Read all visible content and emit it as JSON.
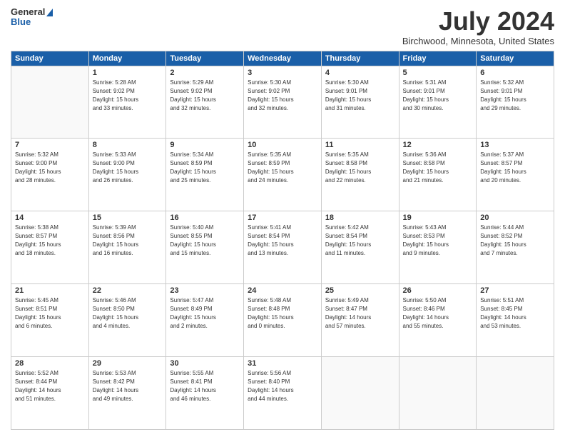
{
  "header": {
    "logo_general": "General",
    "logo_blue": "Blue",
    "title": "July 2024",
    "location": "Birchwood, Minnesota, United States"
  },
  "days_of_week": [
    "Sunday",
    "Monday",
    "Tuesday",
    "Wednesday",
    "Thursday",
    "Friday",
    "Saturday"
  ],
  "weeks": [
    [
      {
        "day": "",
        "info": ""
      },
      {
        "day": "1",
        "info": "Sunrise: 5:28 AM\nSunset: 9:02 PM\nDaylight: 15 hours\nand 33 minutes."
      },
      {
        "day": "2",
        "info": "Sunrise: 5:29 AM\nSunset: 9:02 PM\nDaylight: 15 hours\nand 32 minutes."
      },
      {
        "day": "3",
        "info": "Sunrise: 5:30 AM\nSunset: 9:02 PM\nDaylight: 15 hours\nand 32 minutes."
      },
      {
        "day": "4",
        "info": "Sunrise: 5:30 AM\nSunset: 9:01 PM\nDaylight: 15 hours\nand 31 minutes."
      },
      {
        "day": "5",
        "info": "Sunrise: 5:31 AM\nSunset: 9:01 PM\nDaylight: 15 hours\nand 30 minutes."
      },
      {
        "day": "6",
        "info": "Sunrise: 5:32 AM\nSunset: 9:01 PM\nDaylight: 15 hours\nand 29 minutes."
      }
    ],
    [
      {
        "day": "7",
        "info": "Sunrise: 5:32 AM\nSunset: 9:00 PM\nDaylight: 15 hours\nand 28 minutes."
      },
      {
        "day": "8",
        "info": "Sunrise: 5:33 AM\nSunset: 9:00 PM\nDaylight: 15 hours\nand 26 minutes."
      },
      {
        "day": "9",
        "info": "Sunrise: 5:34 AM\nSunset: 8:59 PM\nDaylight: 15 hours\nand 25 minutes."
      },
      {
        "day": "10",
        "info": "Sunrise: 5:35 AM\nSunset: 8:59 PM\nDaylight: 15 hours\nand 24 minutes."
      },
      {
        "day": "11",
        "info": "Sunrise: 5:35 AM\nSunset: 8:58 PM\nDaylight: 15 hours\nand 22 minutes."
      },
      {
        "day": "12",
        "info": "Sunrise: 5:36 AM\nSunset: 8:58 PM\nDaylight: 15 hours\nand 21 minutes."
      },
      {
        "day": "13",
        "info": "Sunrise: 5:37 AM\nSunset: 8:57 PM\nDaylight: 15 hours\nand 20 minutes."
      }
    ],
    [
      {
        "day": "14",
        "info": "Sunrise: 5:38 AM\nSunset: 8:57 PM\nDaylight: 15 hours\nand 18 minutes."
      },
      {
        "day": "15",
        "info": "Sunrise: 5:39 AM\nSunset: 8:56 PM\nDaylight: 15 hours\nand 16 minutes."
      },
      {
        "day": "16",
        "info": "Sunrise: 5:40 AM\nSunset: 8:55 PM\nDaylight: 15 hours\nand 15 minutes."
      },
      {
        "day": "17",
        "info": "Sunrise: 5:41 AM\nSunset: 8:54 PM\nDaylight: 15 hours\nand 13 minutes."
      },
      {
        "day": "18",
        "info": "Sunrise: 5:42 AM\nSunset: 8:54 PM\nDaylight: 15 hours\nand 11 minutes."
      },
      {
        "day": "19",
        "info": "Sunrise: 5:43 AM\nSunset: 8:53 PM\nDaylight: 15 hours\nand 9 minutes."
      },
      {
        "day": "20",
        "info": "Sunrise: 5:44 AM\nSunset: 8:52 PM\nDaylight: 15 hours\nand 7 minutes."
      }
    ],
    [
      {
        "day": "21",
        "info": "Sunrise: 5:45 AM\nSunset: 8:51 PM\nDaylight: 15 hours\nand 6 minutes."
      },
      {
        "day": "22",
        "info": "Sunrise: 5:46 AM\nSunset: 8:50 PM\nDaylight: 15 hours\nand 4 minutes."
      },
      {
        "day": "23",
        "info": "Sunrise: 5:47 AM\nSunset: 8:49 PM\nDaylight: 15 hours\nand 2 minutes."
      },
      {
        "day": "24",
        "info": "Sunrise: 5:48 AM\nSunset: 8:48 PM\nDaylight: 15 hours\nand 0 minutes."
      },
      {
        "day": "25",
        "info": "Sunrise: 5:49 AM\nSunset: 8:47 PM\nDaylight: 14 hours\nand 57 minutes."
      },
      {
        "day": "26",
        "info": "Sunrise: 5:50 AM\nSunset: 8:46 PM\nDaylight: 14 hours\nand 55 minutes."
      },
      {
        "day": "27",
        "info": "Sunrise: 5:51 AM\nSunset: 8:45 PM\nDaylight: 14 hours\nand 53 minutes."
      }
    ],
    [
      {
        "day": "28",
        "info": "Sunrise: 5:52 AM\nSunset: 8:44 PM\nDaylight: 14 hours\nand 51 minutes."
      },
      {
        "day": "29",
        "info": "Sunrise: 5:53 AM\nSunset: 8:42 PM\nDaylight: 14 hours\nand 49 minutes."
      },
      {
        "day": "30",
        "info": "Sunrise: 5:55 AM\nSunset: 8:41 PM\nDaylight: 14 hours\nand 46 minutes."
      },
      {
        "day": "31",
        "info": "Sunrise: 5:56 AM\nSunset: 8:40 PM\nDaylight: 14 hours\nand 44 minutes."
      },
      {
        "day": "",
        "info": ""
      },
      {
        "day": "",
        "info": ""
      },
      {
        "day": "",
        "info": ""
      }
    ]
  ]
}
